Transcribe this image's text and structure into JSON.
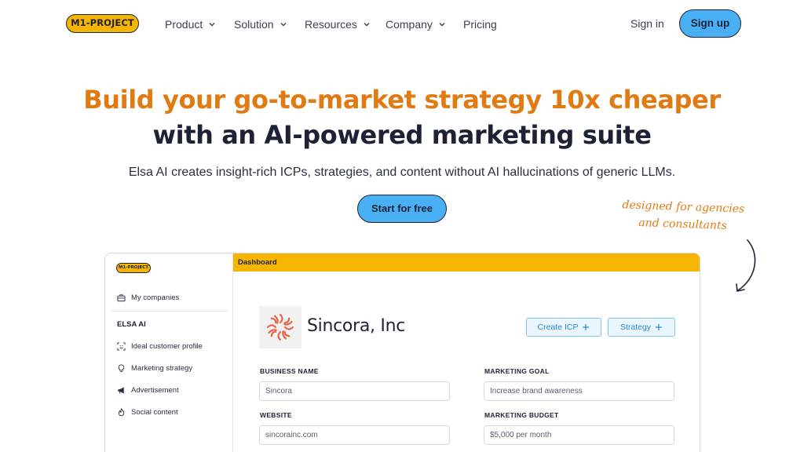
{
  "nav": {
    "logo": "M1-PROJECT",
    "items": [
      {
        "label": "Product",
        "has_dropdown": true
      },
      {
        "label": "Solution",
        "has_dropdown": true
      },
      {
        "label": "Resources",
        "has_dropdown": true
      },
      {
        "label": "Company",
        "has_dropdown": true
      },
      {
        "label": "Pricing",
        "has_dropdown": false
      }
    ],
    "signin": "Sign in",
    "signup": "Sign up"
  },
  "hero": {
    "headline_1": "Build your go-to-market strategy 10x cheaper",
    "headline_2": "with an AI-powered marketing suite",
    "subtitle": "Elsa AI creates insight-rich ICPs, strategies, and content without AI hallucinations of generic LLMs.",
    "cta": "Start for free",
    "note_line_1": "designed for agencies",
    "note_line_2": "and consultants"
  },
  "app": {
    "logo": "M1-PROJECT",
    "topbar_title": "Dashboard",
    "sidebar": {
      "my_companies": "My companies",
      "section": "ELSA AI",
      "items": [
        {
          "label": "Ideal customer profile",
          "icon": "scan-face-icon"
        },
        {
          "label": "Marketing strategy",
          "icon": "lightbulb-icon"
        },
        {
          "label": "Advertisement",
          "icon": "megaphone-icon"
        },
        {
          "label": "Social content",
          "icon": "flame-icon"
        }
      ]
    },
    "company": {
      "name": "Sincora, Inc",
      "create_icp": "Create ICP",
      "strategy": "Strategy"
    },
    "form": {
      "business_name_label": "BUSINESS NAME",
      "business_name_value": "Sincora",
      "website_label": "WEBSITE",
      "website_value": "sincorainc.com",
      "marketing_goal_label": "MARKETING GOAL",
      "marketing_goal_value": "Increase brand awareness",
      "marketing_budget_label": "MARKETING BUDGET",
      "marketing_budget_value": "$5,000 per month"
    }
  },
  "colors": {
    "brand_yellow": "#f6b500",
    "accent_orange": "#e07a12",
    "button_blue": "#4ab0f5",
    "text_dark": "#1e2235"
  }
}
